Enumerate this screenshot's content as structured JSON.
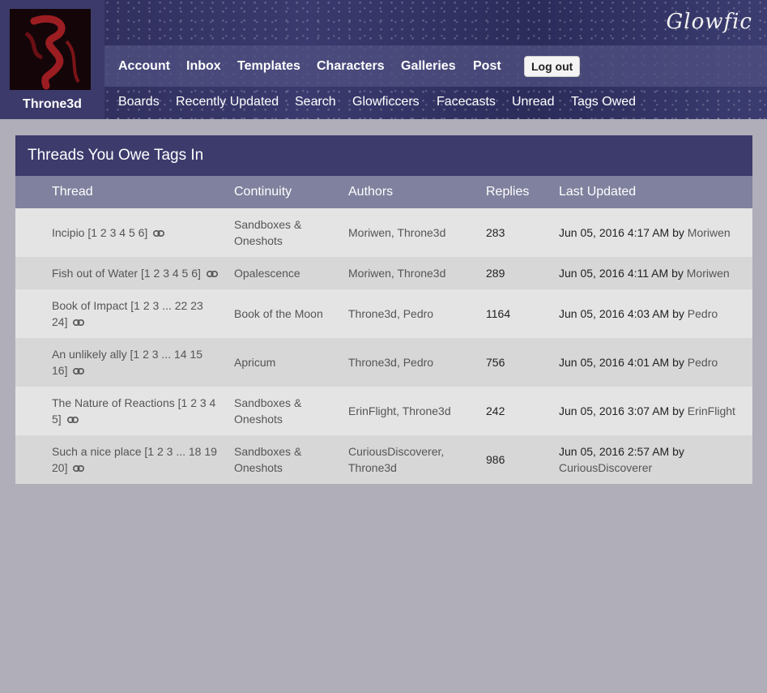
{
  "header": {
    "username": "Throne3d",
    "logo": "Glowfic",
    "nav_main": [
      "Account",
      "Inbox",
      "Templates",
      "Characters",
      "Galleries",
      "Post"
    ],
    "logout_label": "Log out",
    "nav_sub": [
      "Boards",
      "Recently Updated",
      "Search",
      "Glowficcers",
      "Facecasts",
      "Unread",
      "Tags Owed"
    ]
  },
  "panel": {
    "title": "Threads You Owe Tags In",
    "columns": [
      "Thread",
      "Continuity",
      "Authors",
      "Replies",
      "Last Updated"
    ]
  },
  "rows": [
    {
      "title": "Incipio",
      "pages_line1": "[1 2 3 4 5 6]",
      "continuity": "Sandboxes & Oneshots",
      "authors": [
        "Moriwen",
        "Throne3d"
      ],
      "replies": "283",
      "updated": "Jun 05, 2016 4:17 AM by",
      "by": "Moriwen"
    },
    {
      "title": "Fish out of Water",
      "pages_line1": "[1 2 3 4 5 6]",
      "continuity": "Opalescence",
      "authors": [
        "Moriwen",
        "Throne3d"
      ],
      "replies": "289",
      "updated": "Jun 05, 2016 4:11 AM by",
      "by": "Moriwen"
    },
    {
      "title": "Book of Impact",
      "pages_line1": "[1 2 3 ... 22 23",
      "pages_line2": "24]",
      "continuity": "Book of the Moon",
      "authors": [
        "Throne3d",
        "Pedro"
      ],
      "replies": "1164",
      "updated": "Jun 05, 2016 4:03 AM by",
      "by": "Pedro"
    },
    {
      "title": "An unlikely ally",
      "pages_line1": "[1 2 3 ... 14 15",
      "pages_line2": "16]",
      "continuity": "Apricum",
      "authors": [
        "Throne3d",
        "Pedro"
      ],
      "replies": "756",
      "updated": "Jun 05, 2016 4:01 AM by",
      "by": "Pedro"
    },
    {
      "title": "The Nature of Reactions",
      "pages_line1": "[1 2 3 4",
      "pages_line2": "5]",
      "continuity": "Sandboxes & Oneshots",
      "authors": [
        "ErinFlight",
        "Throne3d"
      ],
      "replies": "242",
      "updated": "Jun 05, 2016 3:07 AM by",
      "by": "ErinFlight"
    },
    {
      "title": "Such a nice place",
      "pages_line1": "[1 2 3 ... 18 19",
      "pages_line2": "20]",
      "continuity": "Sandboxes & Oneshots",
      "authors": [
        "CuriousDiscoverer",
        "Throne3d"
      ],
      "replies": "986",
      "updated": "Jun 05, 2016 2:57 AM by",
      "by": "CuriousDiscoverer"
    }
  ],
  "icons": {
    "link": "link-icon"
  },
  "colors": {
    "panel_title_bg": "#3c3b6c",
    "col_head_bg": "#7f819e",
    "page_bg": "#afaeb9"
  }
}
